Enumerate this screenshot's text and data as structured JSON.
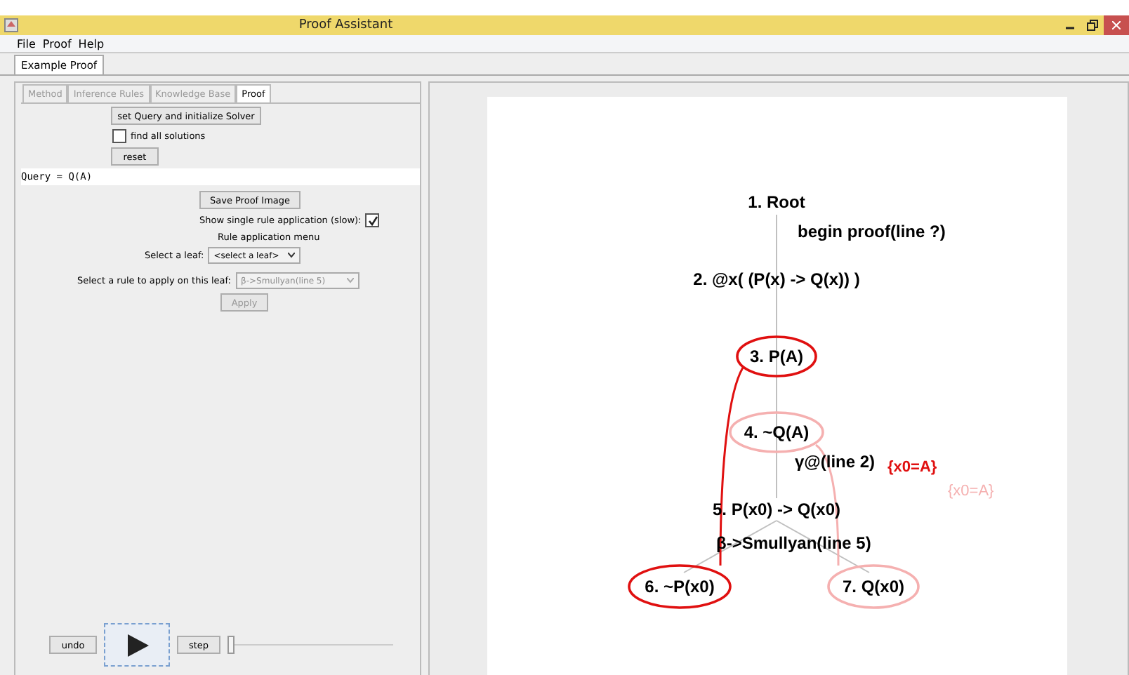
{
  "window": {
    "title": "Proof Assistant"
  },
  "menu": [
    {
      "label": "File"
    },
    {
      "label": "Proof"
    },
    {
      "label": "Help"
    }
  ],
  "document_tabs": [
    {
      "label": "Example Proof",
      "selected": true
    }
  ],
  "panel_tabs": [
    {
      "label": "Method",
      "selected": false,
      "disabled": true
    },
    {
      "label": "Inference Rules",
      "selected": false,
      "disabled": true
    },
    {
      "label": "Knowledge Base",
      "selected": false,
      "disabled": true
    },
    {
      "label": "Proof",
      "selected": true,
      "disabled": false
    }
  ],
  "controls": {
    "init_button": "set Query and initialize Solver",
    "find_all": {
      "label": "find all solutions",
      "checked": false
    },
    "reset_button": "reset",
    "query": "Query = Q(A)",
    "save_button": "Save Proof Image",
    "single_rule": {
      "label": "Show single rule application (slow):",
      "checked": true
    },
    "menu_title": "Rule application menu",
    "leaf_label": "Select a leaf:",
    "leaf_value": "<select a leaf>",
    "rule_label": "Select a rule to apply on this leaf:",
    "rule_value": "β->Smullyan(line 5)",
    "rule_disabled": true,
    "apply_button": "Apply",
    "apply_disabled": true
  },
  "player": {
    "undo": "undo",
    "step": "step",
    "speed": {
      "level": 0
    }
  },
  "proof_tree": {
    "nodes": [
      {
        "label": "1. Root",
        "circled": false
      },
      {
        "label": "2. @x( (P(x) -> Q(x)) )",
        "circled": false
      },
      {
        "label": "3. P(A)",
        "circled": true,
        "color": "#e01010"
      },
      {
        "label": "4. ~Q(A)",
        "circled": true,
        "color": "#f5b0b0"
      },
      {
        "label": "5. P(x0) -> Q(x0)",
        "circled": false
      },
      {
        "label": "6. ~P(x0)",
        "circled": true,
        "color": "#e01010"
      },
      {
        "label": "7. Q(x0)",
        "circled": true,
        "color": "#f5b0b0"
      }
    ],
    "rule_labels": [
      {
        "text": "begin proof(line ?)"
      },
      {
        "text": "γ@(line 2)"
      },
      {
        "text": "β->Smullyan(line 5)"
      }
    ],
    "substitutions": [
      {
        "text": "{x0=A}",
        "color": "#e01010"
      },
      {
        "text": "{x0=A}",
        "color": "#f5b0b0"
      }
    ]
  }
}
